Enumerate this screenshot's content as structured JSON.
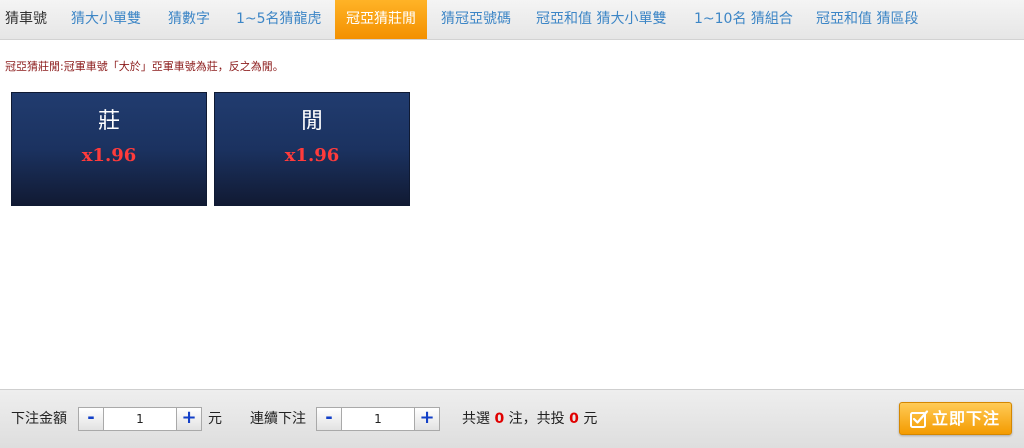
{
  "tabs": [
    {
      "label": "猜車號"
    },
    {
      "label": "猜大小單雙"
    },
    {
      "label": "猜數字"
    },
    {
      "label": "1~5名猜龍虎"
    },
    {
      "label": "冠亞猜莊閒"
    },
    {
      "label": "猜冠亞號碼"
    },
    {
      "label": "冠亞和值 猜大小單雙"
    },
    {
      "label": "1~10名 猜組合"
    },
    {
      "label": "冠亞和值 猜區段"
    }
  ],
  "active_tab": "冠亞猜莊閒",
  "rule_text": "冠亞猜莊閒:冠軍車號「大於」亞軍車號為莊，反之為閒。",
  "options": [
    {
      "name": "莊",
      "odds": "x1.96"
    },
    {
      "name": "閒",
      "odds": "x1.96"
    }
  ],
  "footer": {
    "amount_label": "下注金額",
    "amount_value": "1",
    "currency": "元",
    "consecutive_label": "連續下注",
    "consecutive_value": "1",
    "minus": "-",
    "plus": "+",
    "total_select_prefix": "共選",
    "selected_count": "0",
    "total_select_suffix": "注，共投",
    "total_amount": "0",
    "total_currency": "元",
    "submit_label": "立即下注"
  },
  "colors": {
    "active_tab": "#f7a10e",
    "tab_text": "#3d86c6",
    "odds": "#ff3b3b",
    "rule_text": "#8b1a1a",
    "submit": "#f7a914"
  },
  "icons": {
    "submit": "checkbox-pen-icon"
  }
}
